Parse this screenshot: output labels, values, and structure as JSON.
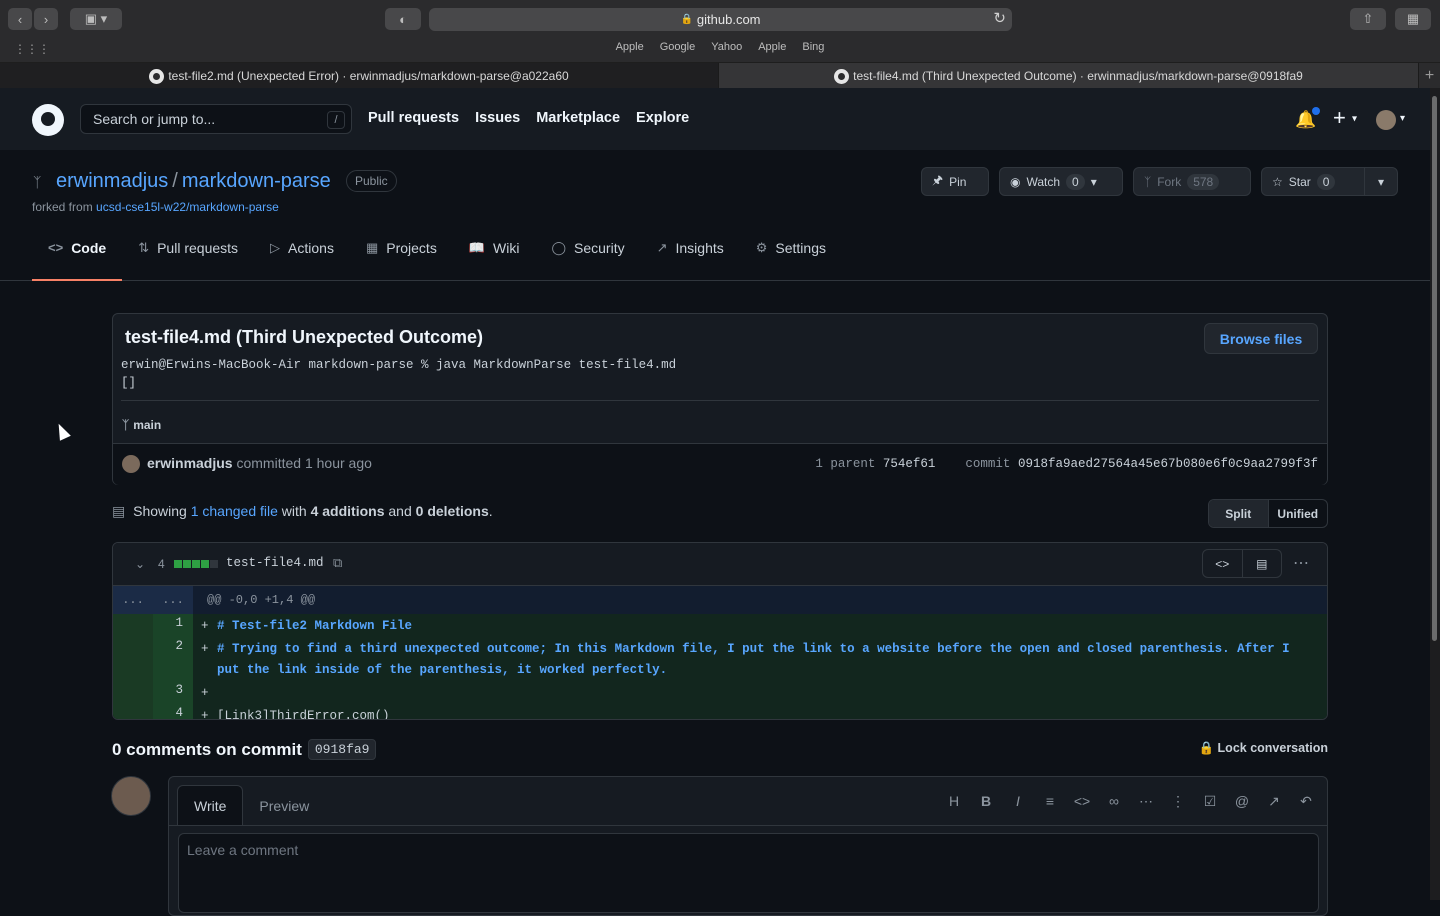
{
  "browser": {
    "url": "github.com",
    "favorites": [
      "Apple",
      "Google",
      "Yahoo",
      "Apple",
      "Bing"
    ],
    "tabs": [
      {
        "title": "test-file2.md (Unexpected Error) · erwinmadjus/markdown-parse@a022a60"
      },
      {
        "title": "test-file4.md (Third Unexpected Outcome) · erwinmadjus/markdown-parse@0918fa9"
      }
    ]
  },
  "header": {
    "search_placeholder": "Search or jump to...",
    "slash": "/",
    "nav": [
      "Pull requests",
      "Issues",
      "Marketplace",
      "Explore"
    ]
  },
  "repo": {
    "owner": "erwinmadjus",
    "separator": "/",
    "name": "markdown-parse",
    "visibility": "Public",
    "forked_prefix": "forked from",
    "forked_from": "ucsd-cse15l-w22/markdown-parse",
    "pin": "Pin",
    "watch": "Watch",
    "watch_count": "0",
    "fork": "Fork",
    "fork_count": "578",
    "star": "Star",
    "star_count": "0",
    "tabs": [
      "Code",
      "Pull requests",
      "Actions",
      "Projects",
      "Wiki",
      "Security",
      "Insights",
      "Settings"
    ]
  },
  "commit": {
    "title": "test-file4.md (Third Unexpected Outcome)",
    "browse": "Browse files",
    "message": "erwin@Erwins-MacBook-Air markdown-parse % java MarkdownParse test-file4.md\n[]",
    "branch": "main",
    "author": "erwinmadjus",
    "committed": "committed 1 hour ago",
    "parent_label": "1 parent",
    "parent": "754ef61",
    "commit_label": "commit",
    "sha": "0918fa9aed27564a45e67b080e6f0c9aa2799f3f"
  },
  "summary": {
    "showing": "Showing",
    "changed": "1 changed file",
    "with": "with",
    "additions": "4 additions",
    "and": "and",
    "deletions": "0 deletions",
    "end": ".",
    "split": "Split",
    "unified": "Unified"
  },
  "diff": {
    "count": "4",
    "file": "test-file4.md",
    "hunk_left": "...",
    "hunk_right": "...",
    "hunk": "@@ -0,0 +1,4 @@",
    "added_color": "#2ea043",
    "neutral_color": "#30363d",
    "lines": [
      {
        "n": "1",
        "sign": "+",
        "text": "# Test-file2 Markdown File"
      },
      {
        "n": "2",
        "sign": "+",
        "text": "# Trying to find a third unexpected outcome; In this Markdown file, I put the link to a website before the open and closed parenthesis. After I put the link inside of the parenthesis, it worked perfectly."
      },
      {
        "n": "3",
        "sign": "+",
        "text": ""
      },
      {
        "n": "4",
        "sign": "+",
        "text": "[Link3]ThirdError.com()"
      }
    ]
  },
  "comments": {
    "title": "0 comments on commit",
    "hash": "0918fa9",
    "lock": "Lock conversation",
    "write": "Write",
    "preview": "Preview",
    "placeholder": "Leave a comment",
    "toolbar_icons": [
      "heading-icon",
      "bold-icon",
      "italic-icon",
      "quote-icon",
      "code-icon",
      "link-icon",
      "bulleted-list-icon",
      "numbered-list-icon",
      "task-list-icon",
      "mention-icon",
      "reference-icon",
      "reply-icon"
    ]
  }
}
